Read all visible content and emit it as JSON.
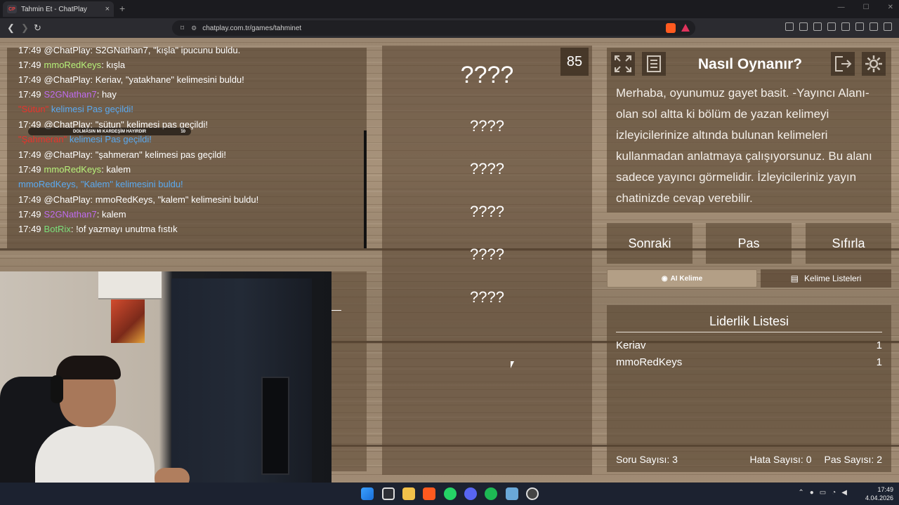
{
  "browser": {
    "tab_title": "Tahmin Et - ChatPlay",
    "tab_favicon": "CP",
    "url": "chatplay.com.tr/games/tahminet",
    "new_tab": "+",
    "close": "×"
  },
  "chat": {
    "lines": [
      {
        "time": "17:49",
        "user": "@ChatPlay",
        "user_color": "#ffffff",
        "text": ": S2GNathan7, \"kışla\" ipucunu buldu."
      },
      {
        "time": "17:49",
        "user": "mmoRedKeys",
        "user_color": "#b7f27a",
        "text": ": kışla"
      },
      {
        "time": "17:49",
        "user": "@ChatPlay",
        "user_color": "#ffffff",
        "text": ": Keriav, \"yatakhane\" kelimesini buldu!"
      },
      {
        "time": "17:49",
        "user": "S2GNathan7",
        "user_color": "#c06cf0",
        "text": ": hay"
      },
      {
        "time": "",
        "user": "\"Sütun\"",
        "user_color": "#e8322c",
        "text": " kelimesi Pas geçildi!",
        "system": true
      },
      {
        "time": "17:49",
        "user": "@ChatPlay",
        "user_color": "#ffffff",
        "text": ": \"sütun\" kelimesi pas geçildi!"
      },
      {
        "time": "",
        "user": "\"Şahmeran\"",
        "user_color": "#e8322c",
        "text": " kelimesi Pas geçildi!",
        "system": true
      },
      {
        "time": "17:49",
        "user": "@ChatPlay",
        "user_color": "#ffffff",
        "text": ": \"şahmeran\" kelimesi pas geçildi!"
      },
      {
        "time": "17:49",
        "user": "mmoRedKeys",
        "user_color": "#b7f27a",
        "text": ": kalem"
      },
      {
        "time": "",
        "user": "mmoRedKeys,",
        "user_color": "#5aa9f0",
        "text": " \"Kalem\" kelimesini buldu!",
        "system": true
      },
      {
        "time": "17:49",
        "user": "@ChatPlay",
        "user_color": "#ffffff",
        "text": ": mmoRedKeys, \"kalem\" kelimesini buldu!"
      },
      {
        "time": "17:49",
        "user": "S2GNathan7",
        "user_color": "#c06cf0",
        "text": ": kalem"
      },
      {
        "time": "17:49",
        "user": "BotRix",
        "user_color": "#7be07b",
        "text": ": !of yazmayı unutma fıstık"
      }
    ],
    "toast": "DOLMASIN MI KARDEŞİM HAYIRDIR",
    "toast_count": "10"
  },
  "game": {
    "timer": "85",
    "main_word": "????",
    "hidden_words": [
      "????",
      "????",
      "????",
      "????",
      "????"
    ]
  },
  "howto": {
    "title": "Nasıl Oynanır?",
    "text": "Merhaba, oyunumuz gayet basit. -Yayıncı Alanı- olan sol altta ki bölüm de yazan kelimeyi izleyicilerinize altında bulunan kelimeleri kullanmadan anlatmaya çalışıyorsunuz. Bu alanı sadece yayıncı görmelidir. İzleyicileriniz yayın chatinizde cevap verebilir.",
    "icons": [
      "fullscreen-icon",
      "document-icon",
      "exit-icon",
      "gear-icon"
    ]
  },
  "controls": {
    "next": "Sonraki",
    "pass": "Pas",
    "reset": "Sıfırla",
    "ai_word": "AI Kelime",
    "word_lists": "Kelime Listeleri"
  },
  "leaderboard": {
    "title": "Liderlik Listesi",
    "rows": [
      {
        "name": "Keriav",
        "score": "1"
      },
      {
        "name": "mmoRedKeys",
        "score": "1"
      }
    ],
    "questions_label": "Soru Sayısı:",
    "questions": "3",
    "errors_label": "Hata Sayısı:",
    "errors": "0",
    "passes_label": "Pas Sayısı:",
    "passes": "2"
  },
  "taskbar": {
    "time": "17:49",
    "date": "4.04.2026",
    "icons": [
      "windows-icon",
      "task-view-icon",
      "file-explorer-icon",
      "brave-icon",
      "whatsapp-icon",
      "discord-icon",
      "spotify-icon",
      "app-icon",
      "chrome-icon"
    ]
  },
  "colors": {
    "accent_wood": "#a08b74",
    "panel": "#5a4632"
  }
}
